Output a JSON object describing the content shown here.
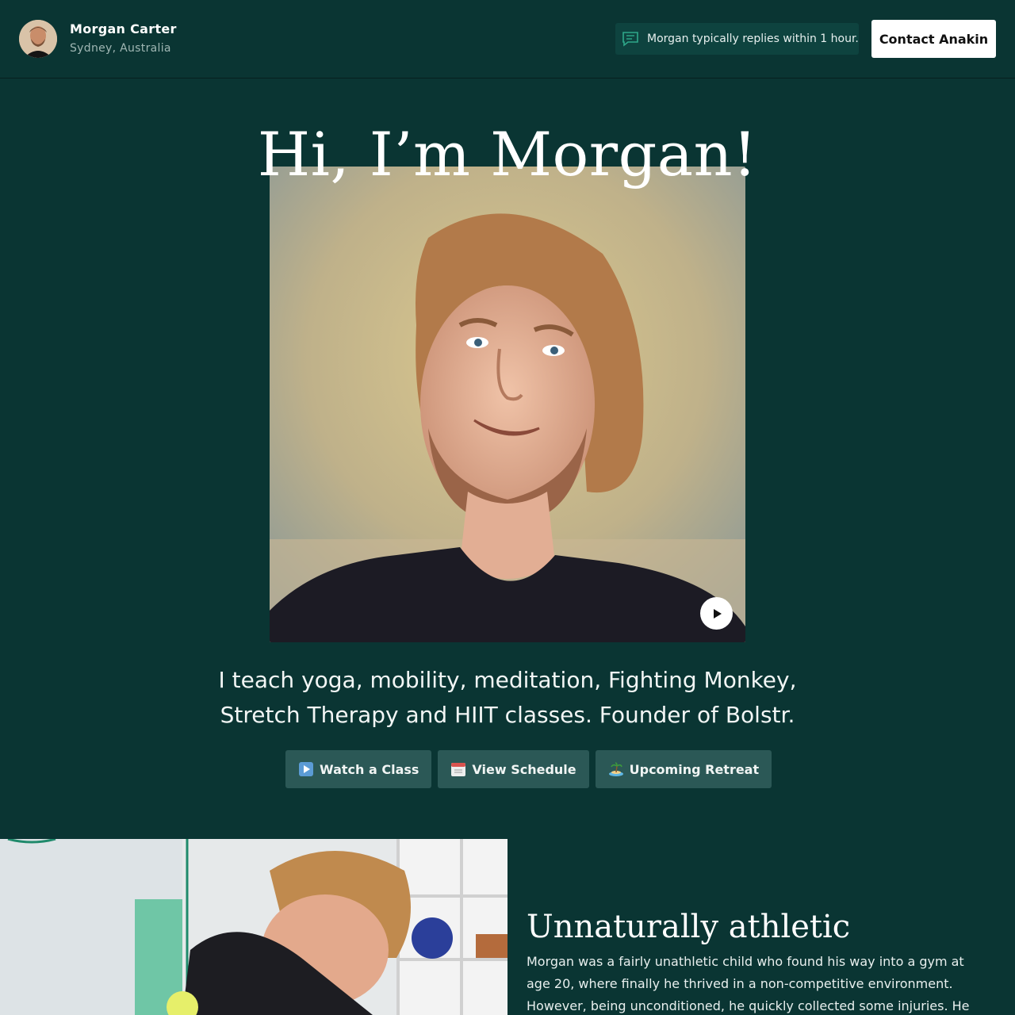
{
  "header": {
    "profile_name": "Morgan Carter",
    "profile_location": "Sydney, Australia",
    "reply_note": "Morgan typically replies within 1 hour.",
    "contact_label": "Contact Anakin"
  },
  "hero": {
    "title": "Hi, I’m Morgan!",
    "tagline": "I teach yoga, mobility, meditation, Fighting Monkey, Stretch Therapy and HIIT classes. Founder of Bolstr."
  },
  "cta": [
    {
      "label": "Watch a Class",
      "icon": "play-button-emoji"
    },
    {
      "label": "View Schedule",
      "icon": "calendar-emoji"
    },
    {
      "label": "Upcoming Retreat",
      "icon": "island-emoji"
    }
  ],
  "about": {
    "title": "Unnaturally athletic",
    "body": "Morgan was a fairly unathletic child who found his way into a gym at age 20, where finally he thrived in a non-competitive environment. However, being unconditioned, he quickly collected some injuries. He"
  },
  "colors": {
    "background": "#0a3533",
    "button_bg": "#2b5856",
    "accent": "#2fa88a"
  }
}
